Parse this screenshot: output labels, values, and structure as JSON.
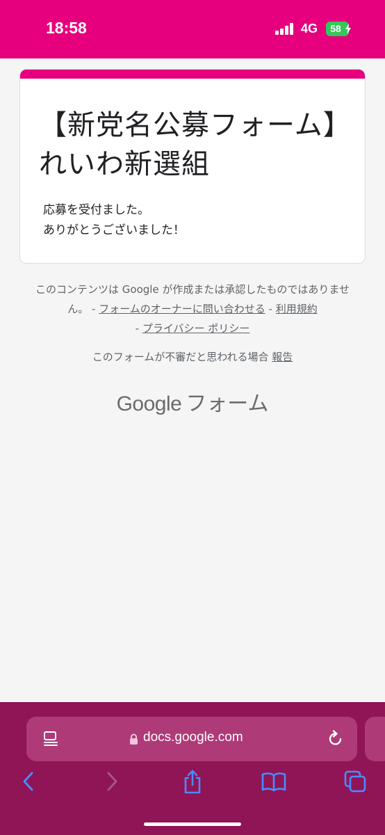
{
  "status_bar": {
    "time": "18:58",
    "network": "4G",
    "battery": "58"
  },
  "form": {
    "title": "【新党名公募フォーム】れいわ新選組",
    "message_line1": "応募を受付ました。",
    "message_line2": "ありがとうございました！",
    "accent_color": "#e6007e"
  },
  "footer": {
    "disclaimer": "このコンテンツは Google が作成または承認したものではありません。 - ",
    "contact_owner": "フォームのオーナーに問い合わせる",
    "sep1": " - ",
    "terms": "利用規約",
    "sep2": " - ",
    "privacy": "プライバシー ポリシー",
    "report_text": "このフォームが不審だと思われる場合 ",
    "report_link": "報告",
    "logo_google": "Google",
    "logo_forms": "フォーム"
  },
  "browser": {
    "url": "docs.google.com",
    "bar_color": "#8f1556",
    "icons": [
      "reader-icon",
      "lock-icon",
      "reload-icon",
      "back-icon",
      "forward-icon",
      "share-icon",
      "bookmarks-icon",
      "tabs-icon"
    ]
  }
}
